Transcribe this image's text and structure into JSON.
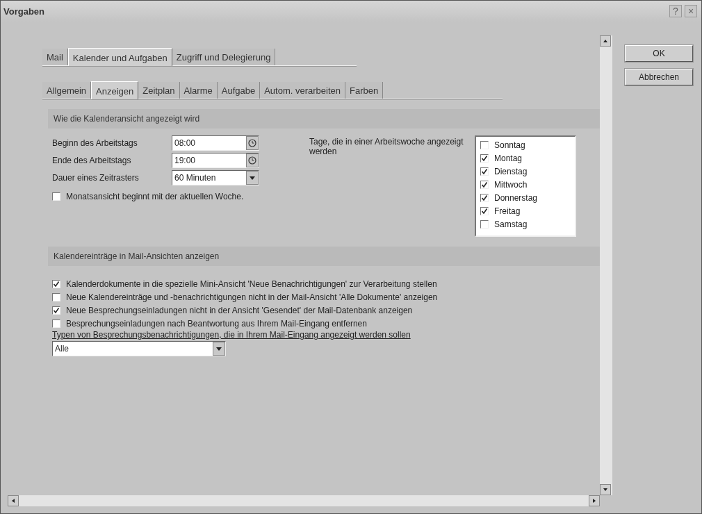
{
  "window": {
    "title": "Vorgaben",
    "help_button": "?",
    "close_button": "×"
  },
  "main_tabs": [
    {
      "label": "Mail",
      "selected": false
    },
    {
      "label": "Kalender und Aufgaben",
      "selected": true
    },
    {
      "label": "Zugriff und Delegierung",
      "selected": false
    }
  ],
  "sub_tabs": [
    {
      "label": "Allgemein",
      "selected": false
    },
    {
      "label": "Anzeigen",
      "selected": true
    },
    {
      "label": "Zeitplan",
      "selected": false
    },
    {
      "label": "Alarme",
      "selected": false
    },
    {
      "label": "Aufgabe",
      "selected": false
    },
    {
      "label": "Autom. verarbeiten",
      "selected": false
    },
    {
      "label": "Farben",
      "selected": false
    }
  ],
  "section_1": {
    "title": "Wie die Kalenderansicht angezeigt wird",
    "fields": [
      {
        "label": "Beginn des Arbeitstags",
        "value": "08:00",
        "kind": "time"
      },
      {
        "label": "Ende des Arbeitstags",
        "value": "19:00",
        "kind": "time"
      },
      {
        "label": "Dauer eines Zeitrasters",
        "value": "60 Minuten",
        "kind": "dropdown"
      }
    ],
    "month_option": {
      "label": "Monatsansicht beginnt mit der aktuellen Woche.",
      "checked": false
    },
    "workdays_label": "Tage, die in einer Arbeitswoche angezeigt werden",
    "workdays": [
      {
        "label": "Sonntag",
        "checked": false
      },
      {
        "label": "Montag",
        "checked": true
      },
      {
        "label": "Dienstag",
        "checked": true
      },
      {
        "label": "Mittwoch",
        "checked": true
      },
      {
        "label": "Donnerstag",
        "checked": true
      },
      {
        "label": "Freitag",
        "checked": true
      },
      {
        "label": "Samstag",
        "checked": false
      }
    ]
  },
  "section_2": {
    "title": "Kalendereinträge in Mail-Ansichten anzeigen",
    "options": [
      {
        "label": "Kalenderdokumente in die spezielle Mini-Ansicht 'Neue Benachrichtigungen' zur Verarbeitung stellen",
        "checked": true
      },
      {
        "label": "Neue Kalendereinträge und -benachrichtigungen nicht in der Mail-Ansicht 'Alle Dokumente' anzeigen",
        "checked": false
      },
      {
        "label": "Neue Besprechungseinladungen nicht in der Ansicht 'Gesendet' der Mail-Datenbank anzeigen",
        "checked": true
      },
      {
        "label": "Besprechungseinladungen nach Beantwortung aus Ihrem Mail-Eingang entfernen",
        "checked": false
      }
    ],
    "types_label": "Typen von Besprechungsbenachrichtigungen, die in Ihrem Mail-Eingang angezeigt werden sollen",
    "types_value": "Alle"
  },
  "buttons": [
    "OK",
    "Abbrechen"
  ]
}
